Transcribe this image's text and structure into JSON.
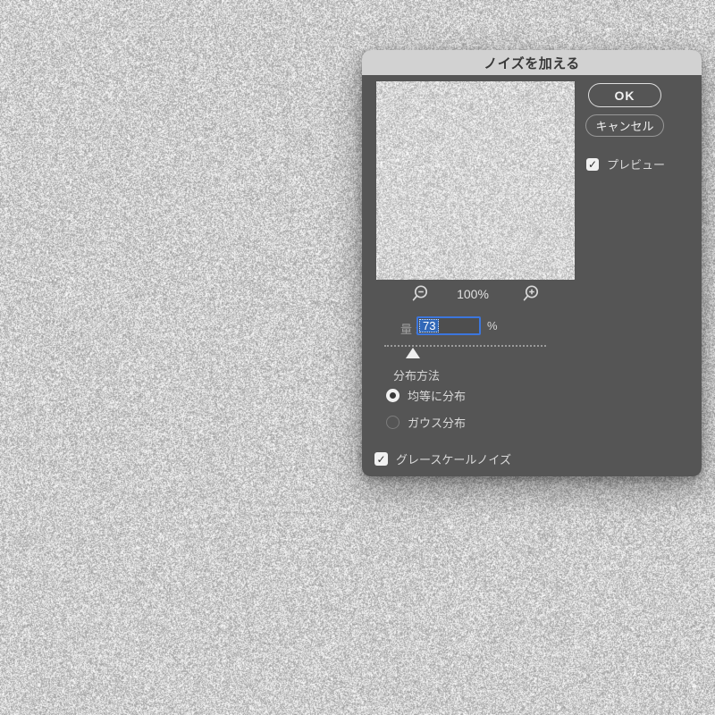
{
  "dialog": {
    "title": "ノイズを加える",
    "buttons": {
      "ok": "OK",
      "cancel": "キャンセル"
    },
    "preview_checkbox": {
      "label": "プレビュー",
      "checked": true
    },
    "zoom": {
      "level": "100%"
    },
    "amount": {
      "label": "量 :",
      "value": "73",
      "unit": "%",
      "slider_position_pct": 17
    },
    "distribution": {
      "label": "分布方法",
      "options": [
        {
          "label": "均等に分布",
          "selected": true
        },
        {
          "label": "ガウス分布",
          "selected": false
        }
      ]
    },
    "monochromatic_checkbox": {
      "label": "グレースケールノイズ",
      "checked": true
    }
  },
  "icons": {
    "check": "✓"
  },
  "colors": {
    "dialog_bg": "#555555",
    "titlebar_bg": "#d2d2d2",
    "titlebar_text": "#383838",
    "label_text": "#d6d6d6",
    "amount_label_text": "#9f9f9f",
    "field_border_blue": "#3c76dd",
    "selection_blue": "#3168b8",
    "ok_border": "#dedede",
    "cancel_border": "#979797",
    "background_noise_base": "#dcdcdc"
  }
}
